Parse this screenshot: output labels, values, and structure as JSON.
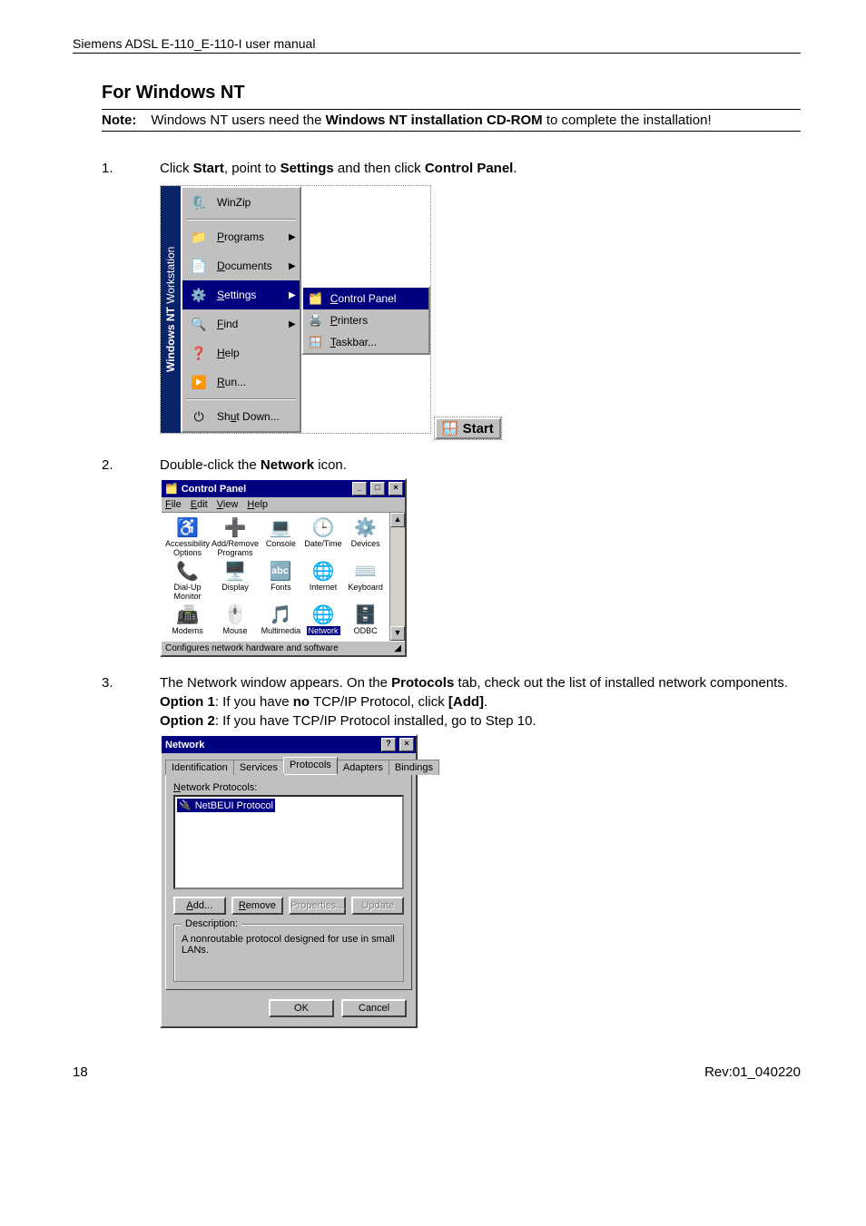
{
  "header": {
    "title": "Siemens ADSL E-110_E-110-I user manual"
  },
  "section_title": "For Windows NT",
  "note": {
    "label": "Note:",
    "pre": "Windows NT users need the ",
    "bold": "Windows NT installation CD-ROM",
    "post": " to complete the installation!"
  },
  "steps": [
    {
      "num": "1.",
      "parts": [
        "Click ",
        "Start",
        ", point to ",
        "Settings",
        " and then click ",
        "Control Panel",
        "."
      ]
    },
    {
      "num": "2.",
      "parts": [
        "Double-click the ",
        "Network",
        " icon."
      ]
    },
    {
      "num": "3.",
      "line1_parts": [
        "The Network window appears. On the ",
        "Protocols",
        " tab, check out the list of installed network components."
      ],
      "option1_parts": [
        "Option 1",
        ": If you have ",
        "no",
        " TCP/IP Protocol, click ",
        "[Add]",
        "."
      ],
      "option2_parts": [
        "Option 2",
        ": If you have TCP/IP Protocol installed, go to Step 10."
      ]
    }
  ],
  "start_menu": {
    "stripe_bold": "Windows NT",
    "stripe_thin": " Workstation",
    "top_item": "WinZip",
    "items": [
      {
        "label": "Programs",
        "arrow": true
      },
      {
        "label": "Documents",
        "arrow": true
      },
      {
        "label": "Settings",
        "arrow": true,
        "selected": true
      },
      {
        "label": "Find",
        "arrow": true
      },
      {
        "label": "Help",
        "arrow": false
      },
      {
        "label": "Run...",
        "arrow": false
      }
    ],
    "bottom_item": "Shut Down...",
    "submenu": [
      {
        "label": "Control Panel",
        "selected": true
      },
      {
        "label": "Printers"
      },
      {
        "label": "Taskbar..."
      }
    ],
    "start_button": "Start"
  },
  "control_panel": {
    "title": "Control Panel",
    "menus": [
      "File",
      "Edit",
      "View",
      "Help"
    ],
    "icons": [
      "Accessibility Options",
      "Add/Remove Programs",
      "Console",
      "Date/Time",
      "Devices",
      "Dial-Up Monitor",
      "Display",
      "Fonts",
      "Internet",
      "Keyboard",
      "Modems",
      "Mouse",
      "Multimedia",
      "Network",
      "ODBC"
    ],
    "selected_index": 13,
    "status": "Configures network hardware and software"
  },
  "network_dialog": {
    "title": "Network",
    "tabs": [
      "Identification",
      "Services",
      "Protocols",
      "Adapters",
      "Bindings"
    ],
    "active_tab": 2,
    "list_label": "Network Protocols:",
    "list_item": "NetBEUI Protocol",
    "buttons": [
      "Add...",
      "Remove",
      "Properties...",
      "Update"
    ],
    "disabled_buttons": [
      2,
      3
    ],
    "desc_label": "Description:",
    "desc_text": "A nonroutable protocol designed for use in small LANs.",
    "ok": "OK",
    "cancel": "Cancel"
  },
  "footer": {
    "page": "18",
    "rev": "Rev:01_040220"
  }
}
